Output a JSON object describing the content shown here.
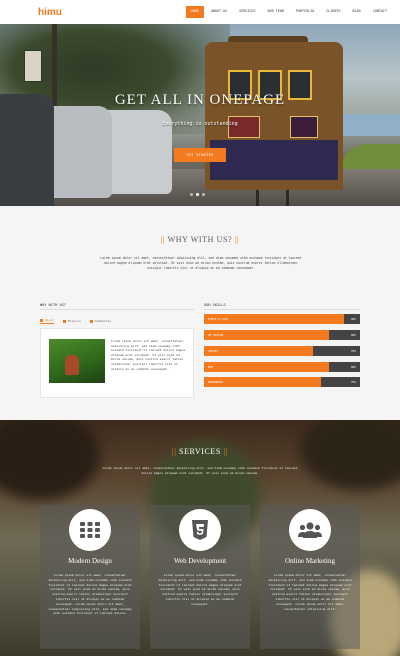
{
  "nav": {
    "logo": "himu",
    "items": [
      "HOME",
      "ABOUT US",
      "SERVICES",
      "OUR TEAM",
      "PORTFOLIO",
      "CLIENTS",
      "BLOG",
      "CONTACT"
    ]
  },
  "hero": {
    "title": "GET ALL IN ONEPAGE",
    "subtitle": "Everything is outstanding",
    "button": "GET STARTED",
    "slides": 3,
    "active_slide": 2
  },
  "why": {
    "title": "WHY WITH US?",
    "text": "Lorem ipsum dolor sit amet, consectetuer adipiscing elit, sed diam nonummy nibh euismod tincidunt ut laoreet dolore magna aliquam erat volutpat. Ut wisi enim ad minim veniam, quis nostrud exerci tation ullamcorper suscipit lobortis nisl ut aliquip ex ea commodo consequat.",
    "left_heading": "WHY WITH US?",
    "tabs": [
      "About",
      "Mission",
      "Community"
    ],
    "card_text": "Lorem ipsum dolor sit amet, consectetuer adipiscing elit, sed diam nonummy nibh euismod tincidunt ut laoreet dolore magna aliquam erat volutpat. Ut wisi enim ad minim veniam, quis nostrud exerci tation ullamcorper suscipit lobortis nisl ut aliquip ex ea commodo consequat.",
    "right_heading": "OUR SKILLS",
    "skills": [
      {
        "label": "HTML5 & CSS3",
        "percent": 90
      },
      {
        "label": "Ux Design",
        "percent": 80
      },
      {
        "label": "Jquery",
        "percent": 70
      },
      {
        "label": "PHP",
        "percent": 80
      },
      {
        "label": "Wordpress",
        "percent": 75
      }
    ]
  },
  "services": {
    "title": "SERVICES",
    "text": "Lorem ipsum dolor sit amet, consectetuer adipiscing elit, sed diam nonummy nibh euismod tincidunt ut laoreet dolore magna aliquam erat volutpat. Ut wisi enim ad minim veniam.",
    "items": [
      {
        "name": "Modern Design",
        "icon": "grid-icon",
        "desc": "Lorem ipsum dolor sit amet, consectetuer adipiscing elit, sed diam nonummy nibh euismod tincidunt ut laoreet dolore magna aliquam erat volutpat. Ut wisi enim ad minim veniam, quis nostrud exerci tation ullamcorper suscipit lobortis nisl ut aliquip ex ea commodo consequat. Lorem ipsum dolor sit amet, consectetuer adipiscing elit, sed diam nonummy nibh euismod tincidunt ut laoreet dolore."
      },
      {
        "name": "Web Development",
        "icon": "html5-icon",
        "desc": "Lorem ipsum dolor sit amet, consectetuer adipiscing elit, sed diam nonummy nibh euismod tincidunt ut laoreet dolore magna aliquam erat volutpat. Ut wisi enim ad minim veniam, quis nostrud exerci tation ullamcorper suscipit lobortis nisl ut aliquip ex ea commodo consequat."
      },
      {
        "name": "Online Marketing",
        "icon": "users-icon",
        "desc": "Lorem ipsum dolor sit amet, consectetuer adipiscing elit, sed diam nonummy nibh euismod tincidunt ut laoreet dolore magna aliquam erat volutpat. Ut wisi enim ad minim veniam, quis nostrud exerci tation ullamcorper suscipit lobortis nisl ut aliquip ex ea commodo consequat. Lorem ipsum dolor sit amet, consectetuer adipiscing elit."
      }
    ]
  },
  "colors": {
    "accent": "#f47a20",
    "dark_bar": "#444444"
  }
}
